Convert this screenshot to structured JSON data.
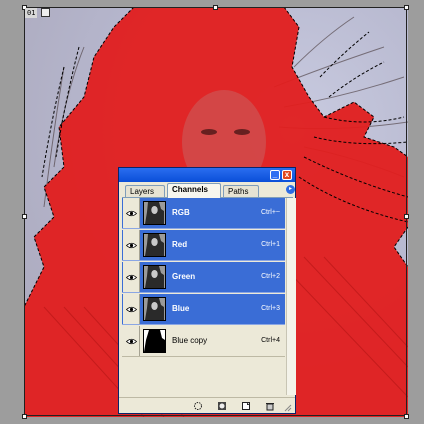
{
  "document": {
    "label": "01",
    "colors": {
      "mask": "#e21d1d",
      "background": "#b7b8cf",
      "selection": "#000000"
    }
  },
  "palette": {
    "buttons": {
      "minimize": "_",
      "close": "x",
      "menu": "▸"
    },
    "tabs": [
      {
        "label": "Layers",
        "active": false
      },
      {
        "label": "Channels",
        "active": true
      },
      {
        "label": "Paths",
        "active": false
      }
    ],
    "channels": [
      {
        "name": "RGB",
        "shortcut": "Ctrl+~",
        "selected": true,
        "visible": true
      },
      {
        "name": "Red",
        "shortcut": "Ctrl+1",
        "selected": true,
        "visible": true
      },
      {
        "name": "Green",
        "shortcut": "Ctrl+2",
        "selected": true,
        "visible": true
      },
      {
        "name": "Blue",
        "shortcut": "Ctrl+3",
        "selected": true,
        "visible": true
      },
      {
        "name": "Blue copy",
        "shortcut": "Ctrl+4",
        "selected": false,
        "visible": true
      }
    ],
    "bottom_icons": [
      "load-channel-as-selection-icon",
      "save-selection-as-channel-icon",
      "new-channel-icon",
      "delete-channel-icon"
    ]
  }
}
